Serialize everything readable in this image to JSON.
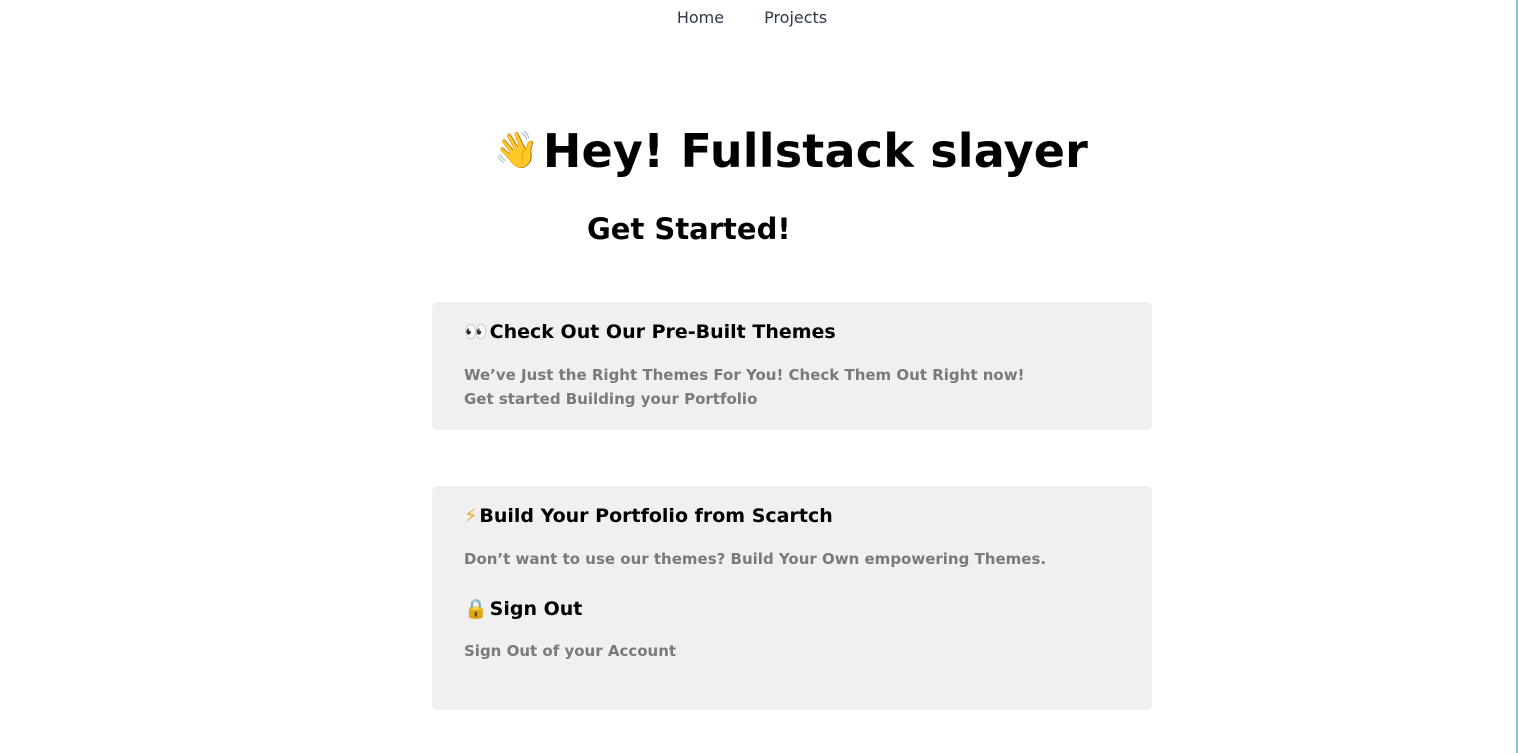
{
  "nav": {
    "items": [
      {
        "label": "Home"
      },
      {
        "label": "Projects"
      }
    ]
  },
  "hero": {
    "emoji": "👋",
    "title": "Hey! Fullstack slayer",
    "subtitle": "Get Started!"
  },
  "cards": [
    {
      "items": [
        {
          "icon": "👀",
          "heading": "Check Out Our Pre-Built Themes",
          "lines": [
            "We’ve Just the Right Themes For You! Check Them Out Right now!",
            "Get started Building your Portfolio"
          ]
        }
      ]
    },
    {
      "items": [
        {
          "icon": "⚡",
          "heading": "Build Your Portfolio from Scartch",
          "lines": [
            "Don’t want to use our themes? Build Your Own empowering Themes."
          ]
        },
        {
          "icon": "🔒",
          "heading": "Sign Out",
          "lines": [
            "Sign Out of your Account"
          ]
        }
      ]
    }
  ],
  "colors": {
    "card_bg": "#f0f0f0",
    "desc_text": "#7a7a7a",
    "nav_text": "#2d3748"
  }
}
